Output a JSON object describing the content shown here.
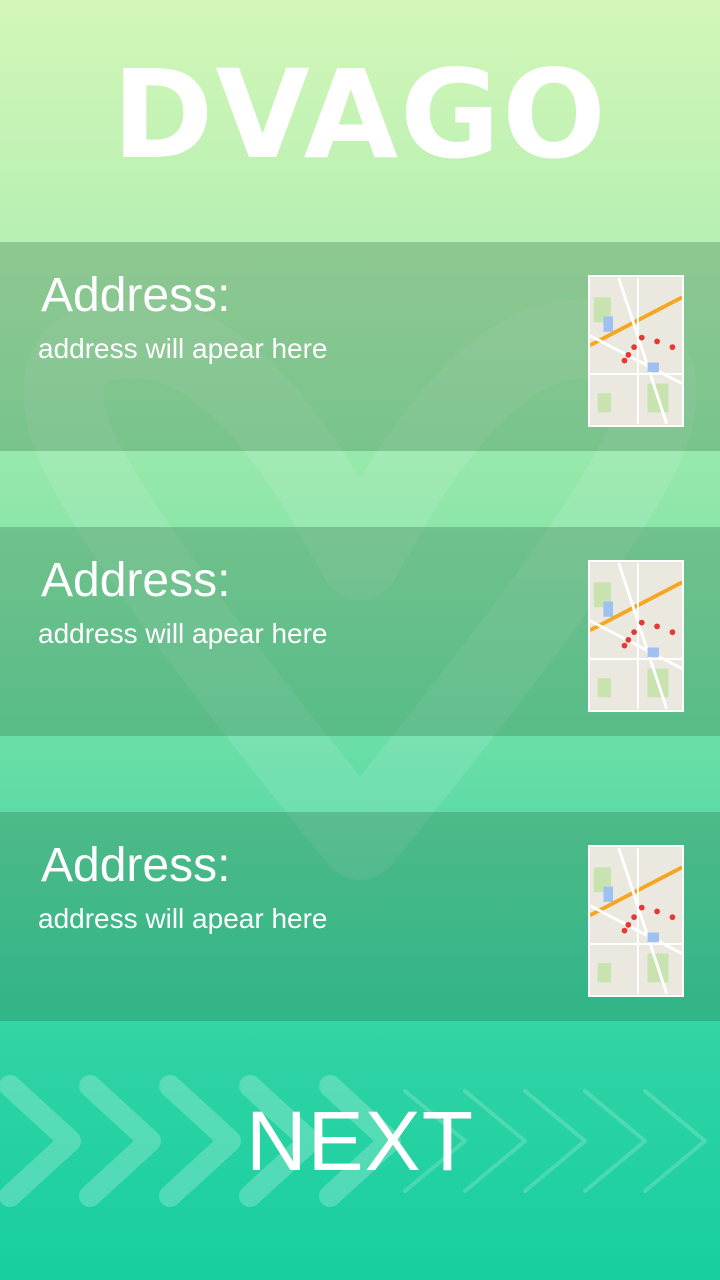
{
  "brand": {
    "logo_text": "DVAGO"
  },
  "addresses": [
    {
      "title": "Address:",
      "subtitle": "address will apear here",
      "thumbnail_icon": "map-thumbnail"
    },
    {
      "title": "Address:",
      "subtitle": "address will apear here",
      "thumbnail_icon": "map-thumbnail"
    },
    {
      "title": "Address:",
      "subtitle": "address will apear here",
      "thumbnail_icon": "map-thumbnail"
    }
  ],
  "next_button": {
    "label": "NEXT"
  },
  "colors": {
    "gradient_top": "#d3f7b8",
    "gradient_bottom": "#17cfa0",
    "text": "#ffffff"
  }
}
